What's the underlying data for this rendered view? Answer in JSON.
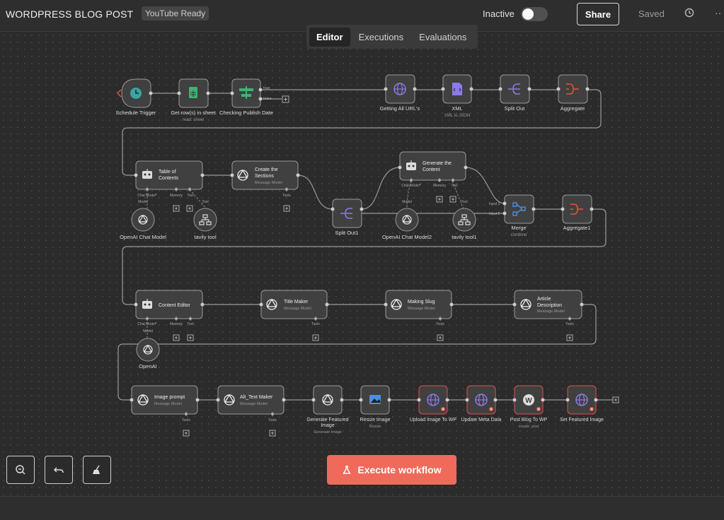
{
  "header": {
    "title": "WORDPRESS BLOG POST",
    "tag": "YouTube Ready",
    "status_label": "Inactive",
    "share_label": "Share",
    "saved_label": "Saved",
    "more_label": "··"
  },
  "tabs": [
    {
      "label": "Editor",
      "active": true
    },
    {
      "label": "Executions",
      "active": false
    },
    {
      "label": "Evaluations",
      "active": false
    }
  ],
  "nodes": {
    "schedule": {
      "label": "Schedule Trigger"
    },
    "getrows": {
      "label": "Get row(s) in sheet",
      "sub": "read: sheet"
    },
    "checking": {
      "label": "Checking Publish Date",
      "branch_true": "true",
      "branch_false": "false"
    },
    "getting": {
      "label": "Getting All URL's"
    },
    "xml": {
      "label": "XML",
      "sub": "XML to JSON"
    },
    "splitout": {
      "label": "Split Out"
    },
    "aggregate": {
      "label": "Aggregate"
    },
    "toc": {
      "title1": "Table of",
      "title2": "Contents",
      "chat": "Chat Model*",
      "memory": "Memory",
      "tool": "Tool"
    },
    "createsections": {
      "title1": "Create the",
      "title2": "Sections",
      "sub": "Message Model",
      "tools": "Tools"
    },
    "splitout1": {
      "label": "Split Out1"
    },
    "generatecontent": {
      "title1": "Generate the",
      "title2": "Content",
      "chat": "Chat Model*",
      "memory": "Memory",
      "tool": "Tool"
    },
    "merge": {
      "label": "Merge",
      "sub": "combine",
      "input1": "Input 1",
      "input2": "Input 2"
    },
    "aggregate1": {
      "label": "Aggregate1"
    },
    "openai_chat": {
      "label": "OpenAI Chat Model",
      "port": "Model"
    },
    "tavily": {
      "label": "tavily tool",
      "port": "Tool"
    },
    "openai_chat2": {
      "label": "OpenAI Chat Model2",
      "port": "Model"
    },
    "tavily1": {
      "label": "tavily tool1",
      "port": "Tool"
    },
    "contenteditor": {
      "title": "Content Editor",
      "chat": "Chat Model*",
      "memory": "Memory",
      "tool": "Tool"
    },
    "titlemaker": {
      "title": "Title Maker",
      "sub": "Message Model",
      "tools": "Tools"
    },
    "makingslug": {
      "title": "Making Slug",
      "sub": "Message Model",
      "tools": "Tools"
    },
    "articledesc": {
      "title1": "Article",
      "title2": "Description",
      "sub": "Message Model",
      "tools": "Tools"
    },
    "openai": {
      "label": "OpenAI",
      "port": "Model"
    },
    "imageprompt": {
      "title": "Image prompt",
      "sub": "Message Model",
      "tools": "Tools"
    },
    "alttext": {
      "title": "Alt_Text Maker",
      "sub": "Message Model",
      "tools": "Tools"
    },
    "genfeatured": {
      "label1": "Generate Featured",
      "label2": "Image",
      "sub": "Generate Image"
    },
    "resize": {
      "label": "Resize Image",
      "sub": "Resize"
    },
    "uploadwp": {
      "label": "Upload Image To WP"
    },
    "updatemeta": {
      "label": "Update Meta Data"
    },
    "postblog": {
      "label": "Post Blog To WP",
      "sub": "create: post"
    },
    "setfeatured": {
      "label": "Set Featured Image"
    }
  },
  "controls": {
    "execute_label": "Execute workflow"
  },
  "colors": {
    "accent": "#ef6a5a",
    "node_bg": "#404040",
    "node_border": "#9a9a9a",
    "error_border": "#e24f4f",
    "purple": "#8c7ae6",
    "green": "#3cb371",
    "red": "#e8503a",
    "teal": "#3aa3a3",
    "blue": "#4a90e2"
  }
}
